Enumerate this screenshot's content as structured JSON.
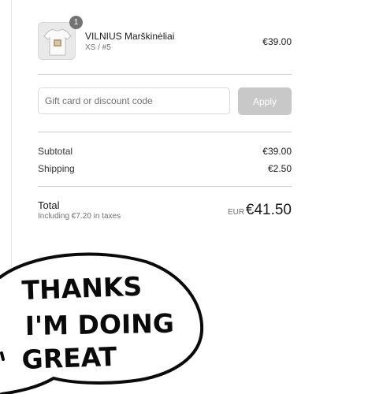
{
  "cart": {
    "items": [
      {
        "quantity": "1",
        "name": "VILNIUS Marškinėliai",
        "variant": "XS / #5",
        "price": "€39.00",
        "thumbnail_icon": "tshirt-icon"
      }
    ]
  },
  "discount": {
    "placeholder": "Gift card or discount code",
    "apply_label": "Apply"
  },
  "summary": {
    "subtotal_label": "Subtotal",
    "subtotal_value": "€39.00",
    "shipping_label": "Shipping",
    "shipping_value": "€2.50",
    "total_label": "Total",
    "tax_note": "Including €7.20 in taxes",
    "currency": "EUR",
    "total_value": "€41.50"
  },
  "doodle": {
    "line1": "THANKS",
    "line2": "I'M DOING",
    "line3": "GREAT"
  },
  "colors": {
    "apply_disabled": "#c8c8c8",
    "divider": "#cfcfcf",
    "badge": "#737373"
  }
}
